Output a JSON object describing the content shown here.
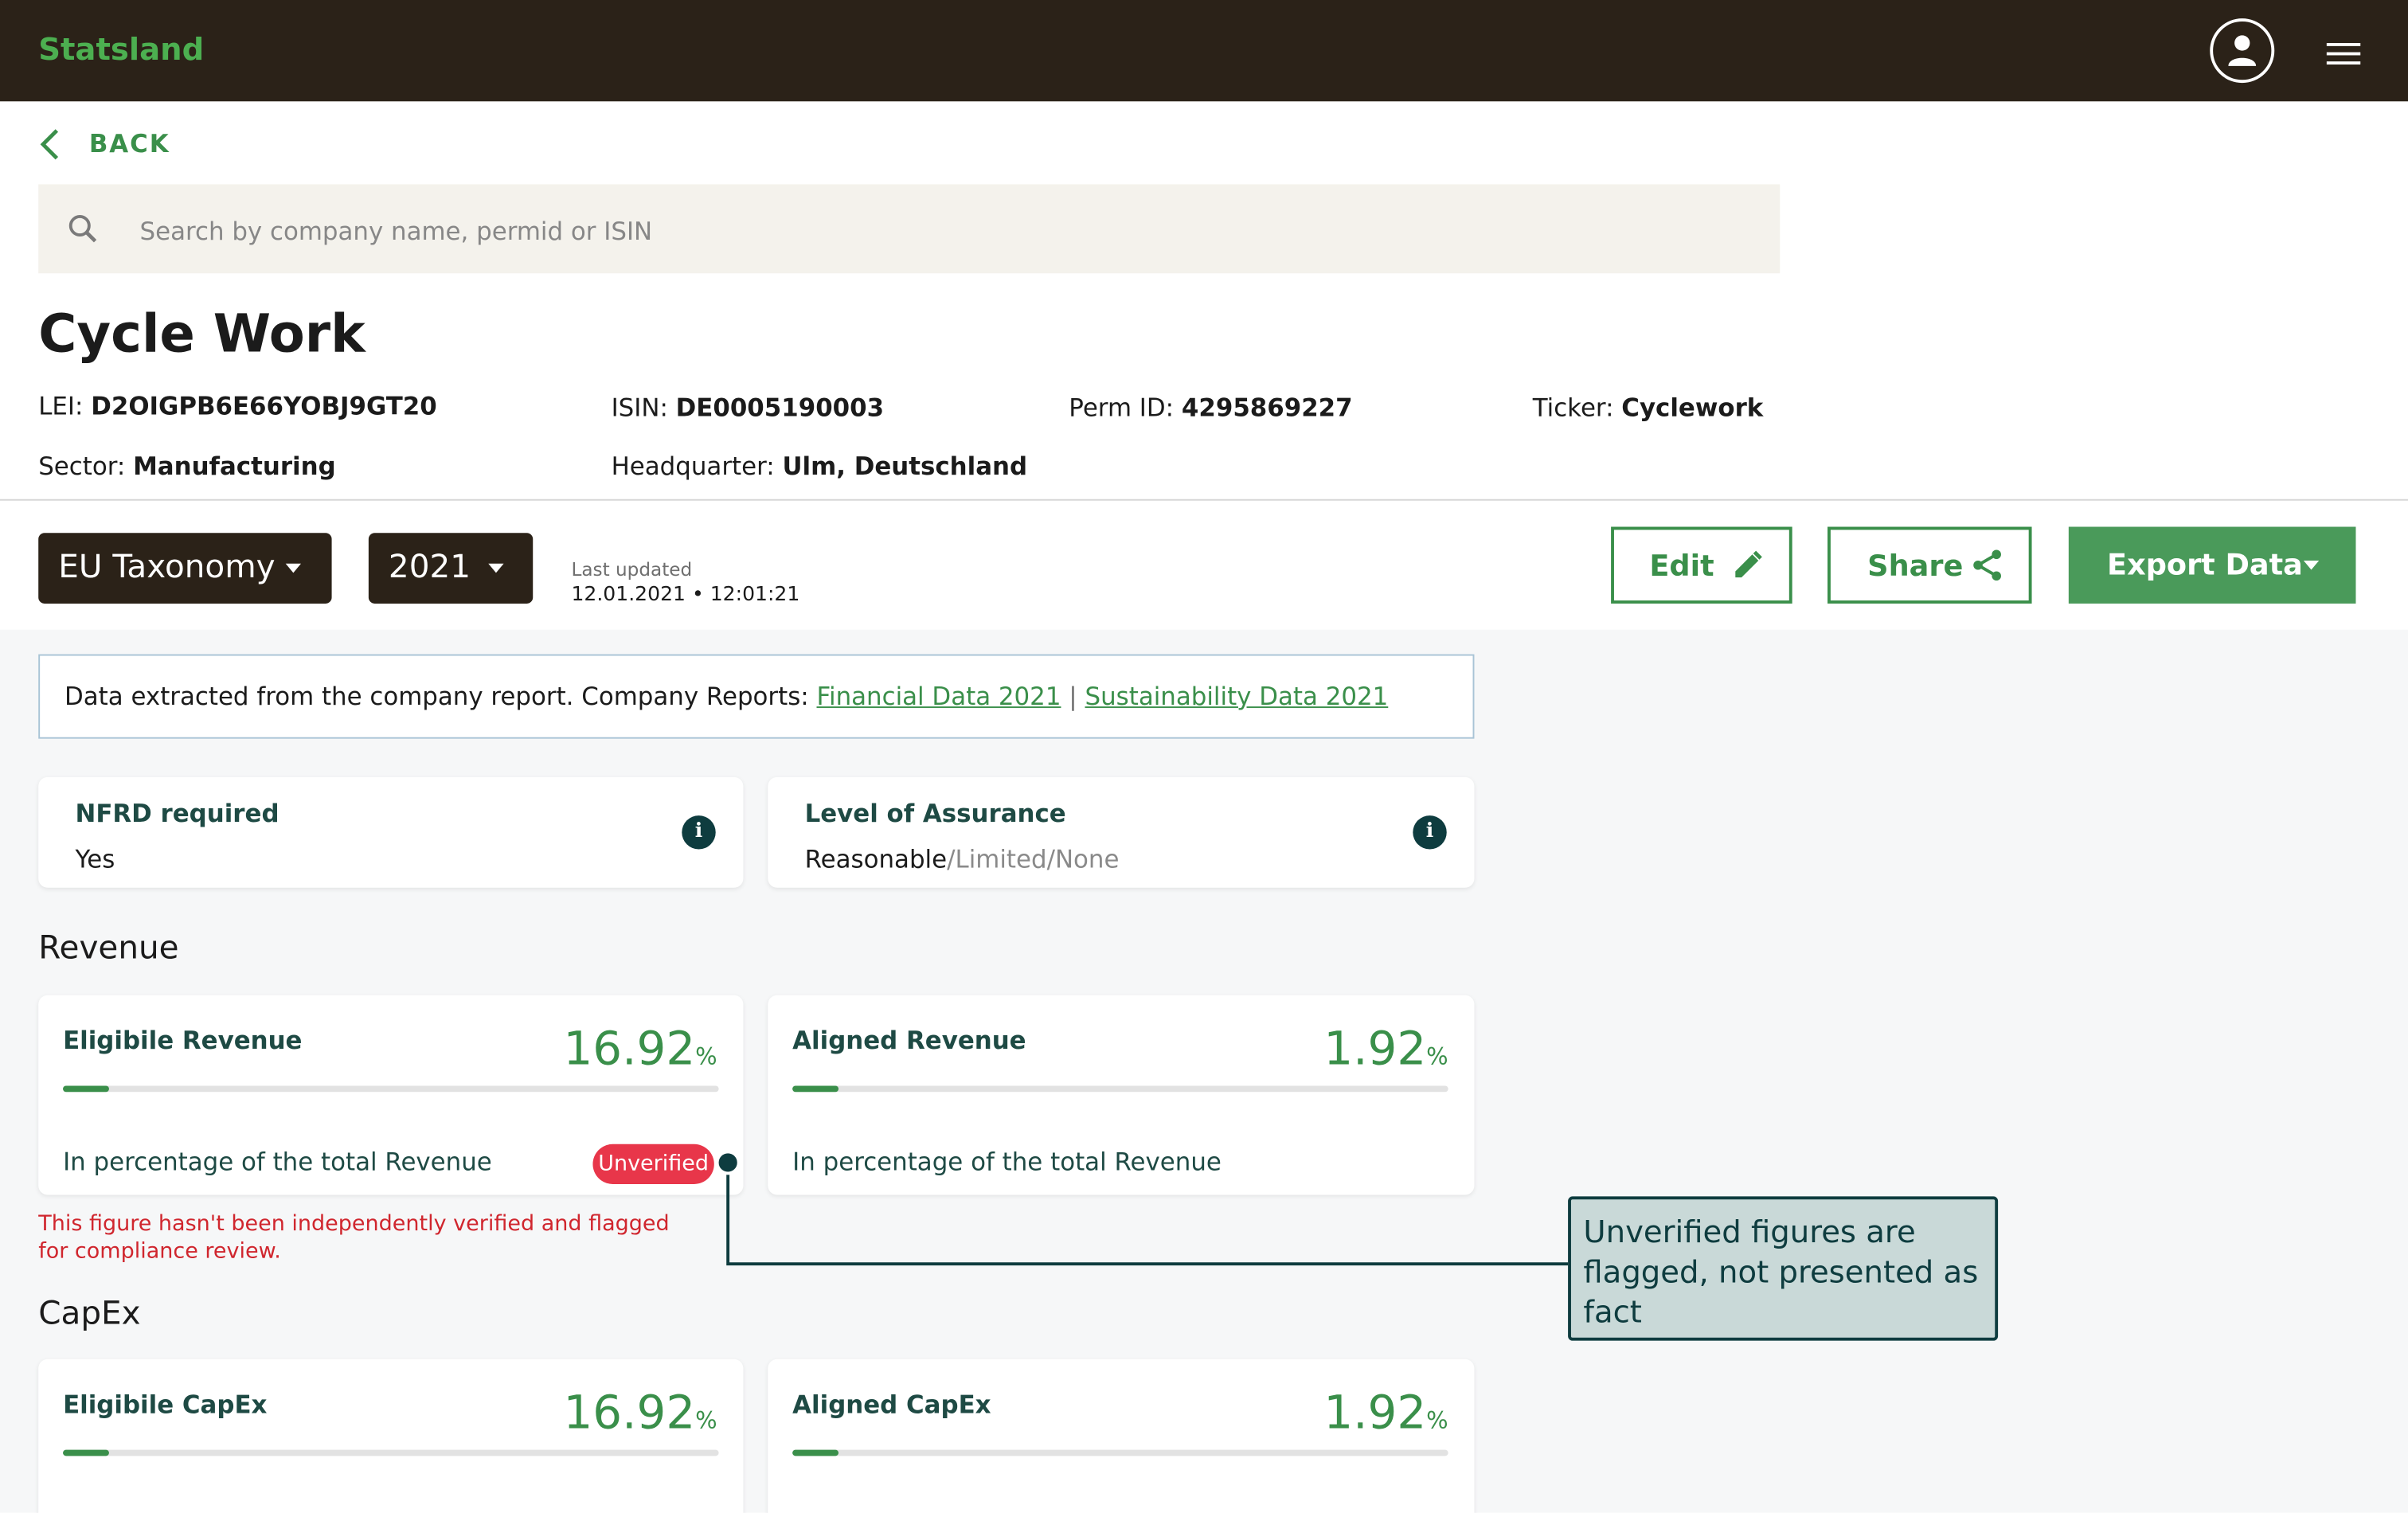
{
  "app": {
    "brand": "Statsland"
  },
  "nav": {
    "back_label": "BACK"
  },
  "search": {
    "placeholder": "Search by company name, permid or ISIN",
    "value": ""
  },
  "company": {
    "name": "Cycle Work",
    "lei_label": "LEI:",
    "lei": "D2OIGPB6E66YOBJ9GT20",
    "isin_label": "ISIN:",
    "isin": "DE0005190003",
    "permid_label": "Perm ID:",
    "permid": "4295869227",
    "ticker_label": "Ticker:",
    "ticker": "Cyclework",
    "sector_label": "Sector:",
    "sector": "Manufacturing",
    "hq_label": "Headquarter:",
    "hq": "Ulm, Deutschland"
  },
  "toolbar": {
    "framework": "EU Taxonomy",
    "year": "2021",
    "last_updated_label": "Last updated",
    "last_updated_value": "12.01.2021 • 12:01:21",
    "edit_label": "Edit",
    "share_label": "Share",
    "export_label": "Export Data"
  },
  "source": {
    "text": "Data extracted from the company report. Company Reports:",
    "link1": "Financial Data 2021",
    "separator": "|",
    "link2": "Sustainability Data 2021"
  },
  "nfrd": {
    "title": "NFRD required",
    "value": "Yes",
    "icon": "info-icon"
  },
  "assurance": {
    "title": "Level of Assurance",
    "selected": "Reasonable",
    "rest": "/Limited/None",
    "icon": "info-icon"
  },
  "revenue": {
    "section_title": "Revenue",
    "eligible": {
      "title": "Eligibile Revenue",
      "value": "16.92",
      "unit": "%",
      "fraction": 0.0692,
      "desc": "In percentage of the total Revenue"
    },
    "aligned": {
      "title": "Aligned Revenue",
      "value": "1.92",
      "unit": "%",
      "fraction": 0.0692,
      "desc": "In percentage of the total Revenue"
    },
    "badge": "Unverified",
    "warning": "This figure hasn't been independently verified and flagged for compliance review."
  },
  "capex": {
    "section_title": "CapEx",
    "eligible": {
      "title": "Eligibile CapEx",
      "value": "16.92",
      "unit": "%",
      "fraction": 0.0692
    },
    "aligned": {
      "title": "Aligned CapEx",
      "value": "1.92",
      "unit": "%",
      "fraction": 0.0692
    }
  },
  "callout": {
    "text": "Unverified figures are flagged, not presented as fact"
  },
  "colors": {
    "topbar": "#2b2218",
    "accent": "#3a8f4a",
    "danger": "#e8364a",
    "callout_bg": "#c9d9d8",
    "callout_border": "#0e3c3f"
  }
}
